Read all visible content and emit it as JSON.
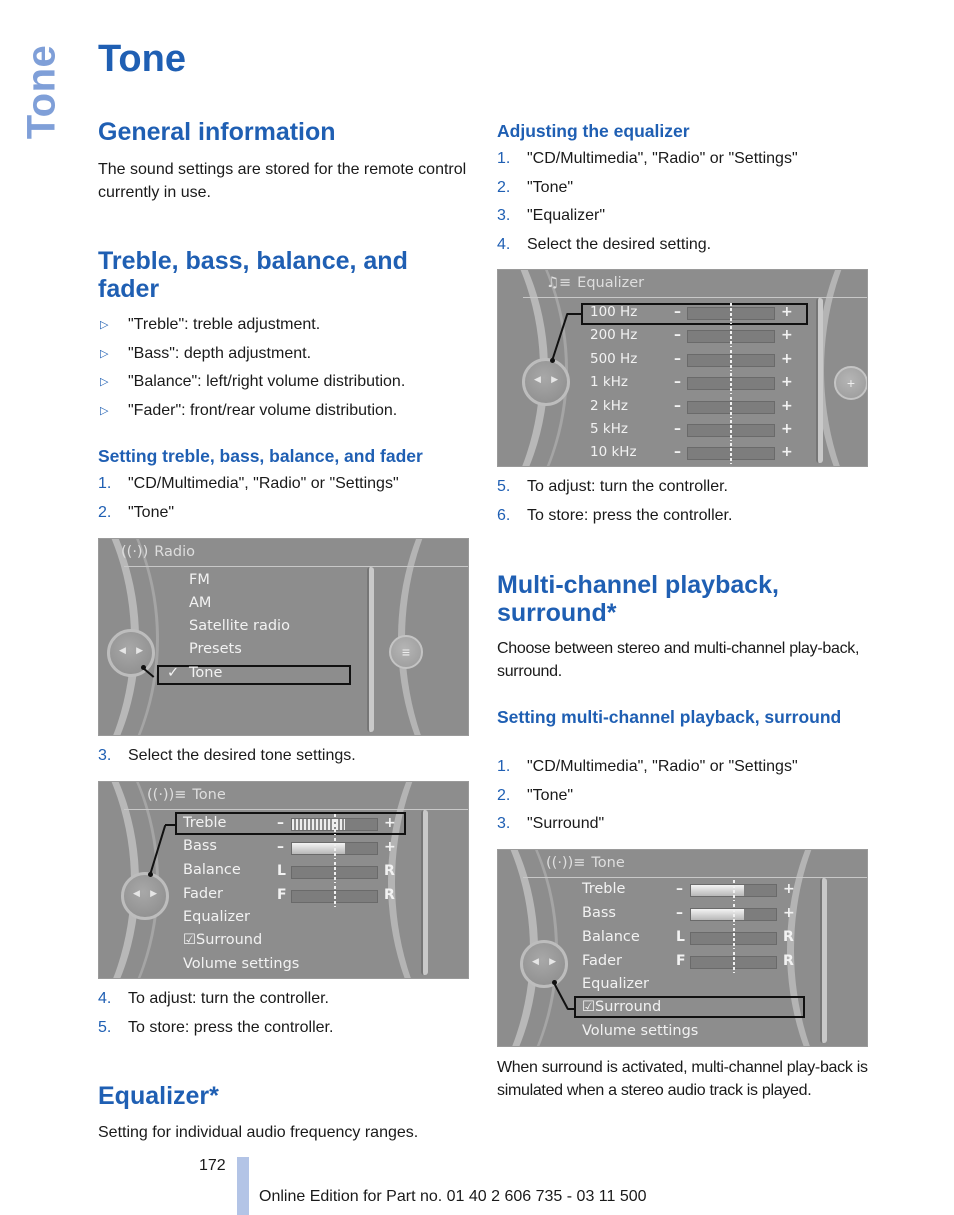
{
  "side_tab": "Tone",
  "page_title": "Tone",
  "left": {
    "general": {
      "heading": "General information",
      "text": "The sound settings are stored for the remote control currently in use."
    },
    "treble": {
      "heading": "Treble, bass, balance, and fader",
      "bullets": [
        "\"Treble\": treble adjustment.",
        "\"Bass\": depth adjustment.",
        "\"Balance\": left/right volume distribution.",
        "\"Fader\": front/rear volume distribution."
      ],
      "bullet_marker": "▷",
      "subheading": "Setting treble, bass, balance, and fader",
      "steps_a": [
        {
          "n": "1.",
          "text": "\"CD/Multimedia\", \"Radio\" or \"Settings\""
        },
        {
          "n": "2.",
          "text": "\"Tone\""
        }
      ],
      "steps_b": [
        {
          "n": "3.",
          "text": "Select the desired tone settings."
        }
      ],
      "steps_c": [
        {
          "n": "4.",
          "text": "To adjust: turn the controller."
        },
        {
          "n": "5.",
          "text": "To store: press the controller."
        }
      ]
    },
    "radio_screen": {
      "header_icon": "radio-antenna-icon",
      "header": "Radio",
      "items": [
        "FM",
        "AM",
        "Satellite radio",
        "Presets",
        "Tone"
      ],
      "selected_index": 4,
      "check": "✓"
    },
    "tone_screen": {
      "header_icon": "tone-antenna-icon",
      "header": "Tone",
      "sliders": [
        {
          "label": "Treble",
          "left": "–",
          "right": "+",
          "value_fraction": 0.62,
          "style": "ticks"
        },
        {
          "label": "Bass",
          "left": "–",
          "right": "+",
          "value_fraction": 0.62,
          "style": "solid"
        },
        {
          "label": "Balance",
          "left": "L",
          "right": "R",
          "value_fraction": 0.5,
          "style": "none"
        },
        {
          "label": "Fader",
          "left": "F",
          "right": "R",
          "value_fraction": 0.5,
          "style": "none"
        }
      ],
      "items": [
        "Equalizer",
        "Surround",
        "Volume settings"
      ],
      "surround_check": "☑",
      "selected": "Treble"
    },
    "equalizer": {
      "heading": "Equalizer*",
      "text": "Setting for individual audio frequency ranges."
    }
  },
  "right": {
    "adjust": {
      "subheading": "Adjusting the equalizer",
      "steps_a": [
        {
          "n": "1.",
          "text": "\"CD/Multimedia\", \"Radio\" or \"Settings\""
        },
        {
          "n": "2.",
          "text": "\"Tone\""
        },
        {
          "n": "3.",
          "text": "\"Equalizer\""
        },
        {
          "n": "4.",
          "text": "Select the desired setting."
        }
      ],
      "steps_b": [
        {
          "n": "5.",
          "text": "To adjust: turn the controller."
        },
        {
          "n": "6.",
          "text": "To store: press the controller."
        }
      ]
    },
    "eq_screen": {
      "header_icon": "equalizer-icon",
      "header": "Equalizer",
      "bands": [
        {
          "label": "100 Hz",
          "value_fraction": 0.5
        },
        {
          "label": "200 Hz",
          "value_fraction": 0.5
        },
        {
          "label": "500 Hz",
          "value_fraction": 0.5
        },
        {
          "label": "1 kHz",
          "value_fraction": 0.5
        },
        {
          "label": "2 kHz",
          "value_fraction": 0.5
        },
        {
          "label": "5 kHz",
          "value_fraction": 0.5
        },
        {
          "label": "10 kHz",
          "value_fraction": 0.5
        }
      ],
      "minus": "–",
      "plus": "+",
      "selected": "100 Hz",
      "side_button": "+"
    },
    "multichannel": {
      "heading": "Multi-channel playback, surround*",
      "text": "Choose between stereo and multi-channel play-back, surround.",
      "subheading": "Setting multi-channel playback, surround",
      "steps": [
        {
          "n": "1.",
          "text": "\"CD/Multimedia\", \"Radio\" or \"Settings\""
        },
        {
          "n": "2.",
          "text": "\"Tone\""
        },
        {
          "n": "3.",
          "text": "\"Surround\""
        }
      ],
      "after_text": "When surround is activated, multi-channel play-back is simulated when a stereo audio track is played."
    },
    "surround_screen": {
      "header": "Tone",
      "sliders": [
        {
          "label": "Treble",
          "left": "–",
          "right": "+",
          "value_fraction": 0.62,
          "style": "solid"
        },
        {
          "label": "Bass",
          "left": "–",
          "right": "+",
          "value_fraction": 0.62,
          "style": "solid"
        },
        {
          "label": "Balance",
          "left": "L",
          "right": "R",
          "value_fraction": 0.5,
          "style": "none"
        },
        {
          "label": "Fader",
          "left": "F",
          "right": "R",
          "value_fraction": 0.5,
          "style": "none"
        }
      ],
      "items": [
        "Equalizer",
        "Surround",
        "Volume settings"
      ],
      "surround_check": "☑",
      "selected": "Surround"
    }
  },
  "footer": {
    "page_number": "172",
    "edition": "Online Edition for Part no. 01 40 2 606 735 - 03 11 500"
  }
}
